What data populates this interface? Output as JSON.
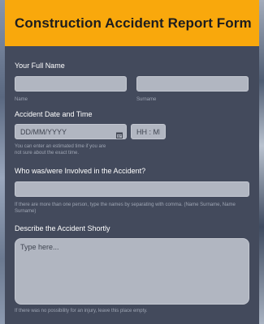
{
  "form": {
    "title": "Construction Accident Report Form",
    "full_name": {
      "label": "Your Full Name",
      "first": {
        "value": "",
        "sublabel": "Name"
      },
      "last": {
        "value": "",
        "sublabel": "Surname"
      }
    },
    "accident_date": {
      "label": "Accident Date and Time",
      "date_placeholder": "DD/MM/YYYY",
      "time_placeholder": "HH : MM",
      "hint": "You can enter an estimated time if you are not sure about the exact time.",
      "calendar_icon": "calendar-icon"
    },
    "involved": {
      "label": "Who was/were Involved in the Accident?",
      "value": "",
      "hint": "If there are more than one person, type the names by separating with comma. (Name Surname, Name Surname)"
    },
    "description": {
      "label": "Describe the Accident Shortly",
      "placeholder": "Type here...",
      "hint": "If there was no possibility for an injury, leave this place empty."
    }
  },
  "colors": {
    "header": "#f9a80c",
    "card": "#434a5c",
    "field": "#b1b6c1",
    "label": "#ffffff",
    "hint": "#9fa6b4"
  }
}
